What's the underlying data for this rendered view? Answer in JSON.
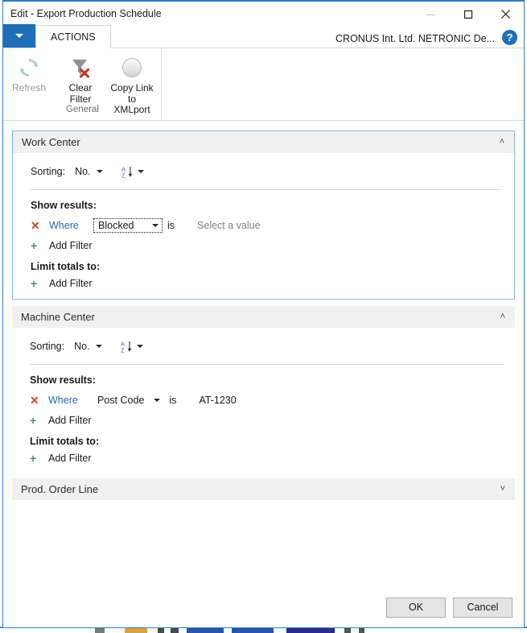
{
  "window": {
    "title": "Edit - Export Production Schedule",
    "controls": {
      "minimize": "minimize-icon",
      "maximize": "maximize-icon",
      "close": "close-icon"
    }
  },
  "tabstrip": {
    "app_menu_icon": "chevron-down-icon",
    "tab_label": "ACTIONS",
    "company": "CRONUS Int. Ltd. NETRONIC De...",
    "help_icon": "?"
  },
  "ribbon": {
    "group_label": "General",
    "items": [
      {
        "label": "Refresh",
        "icon": "refresh-icon",
        "disabled": true
      },
      {
        "label": "Clear\nFilter",
        "label_line1": "Clear",
        "label_line2": "Filter",
        "icon": "clear-filter-icon",
        "disabled": false
      },
      {
        "label": "Copy Link to XMLport",
        "label_line1": "Copy Link to",
        "label_line2": "XMLport",
        "icon": "copy-link-icon",
        "disabled": false
      }
    ]
  },
  "sections": [
    {
      "title": "Work Center",
      "expanded": true,
      "active": true,
      "chevron": "˄",
      "sorting": {
        "label": "Sorting:",
        "field": "No.",
        "direction_icon": "sort-ascending-icon",
        "direction_letters": {
          "top": "A",
          "bottom": "Z"
        }
      },
      "show_results_label": "Show results:",
      "filters": [
        {
          "remove_icon": "✕",
          "conjunction": "Where",
          "field": "Blocked",
          "field_focused": true,
          "operator": "is",
          "value": "Select a value",
          "value_is_placeholder": true
        }
      ],
      "add_filter_label": "Add Filter",
      "limit_totals_label": "Limit totals to:",
      "limit_add_filter_label": "Add Filter"
    },
    {
      "title": "Machine Center",
      "expanded": true,
      "active": false,
      "chevron": "˄",
      "sorting": {
        "label": "Sorting:",
        "field": "No.",
        "direction_icon": "sort-ascending-icon",
        "direction_letters": {
          "top": "A",
          "bottom": "Z"
        }
      },
      "show_results_label": "Show results:",
      "filters": [
        {
          "remove_icon": "✕",
          "conjunction": "Where",
          "field": "Post Code",
          "field_focused": false,
          "operator": "is",
          "value": "AT-1230",
          "value_is_placeholder": false
        }
      ],
      "add_filter_label": "Add Filter",
      "limit_totals_label": "Limit totals to:",
      "limit_add_filter_label": "Add Filter"
    },
    {
      "title": "Prod. Order Line",
      "expanded": false,
      "active": false,
      "chevron": "˅"
    }
  ],
  "footer": {
    "ok_label": "OK",
    "cancel_label": "Cancel"
  },
  "colors": {
    "accent": "#1e6fb8",
    "window_border": "#2c7fd0",
    "link": "#2868b8",
    "remove_x": "#d9452c",
    "add_plus": "#41935f",
    "header_bg": "#f0f0f0",
    "active_section_border": "#8cb6e0",
    "placeholder_text": "#808080"
  }
}
